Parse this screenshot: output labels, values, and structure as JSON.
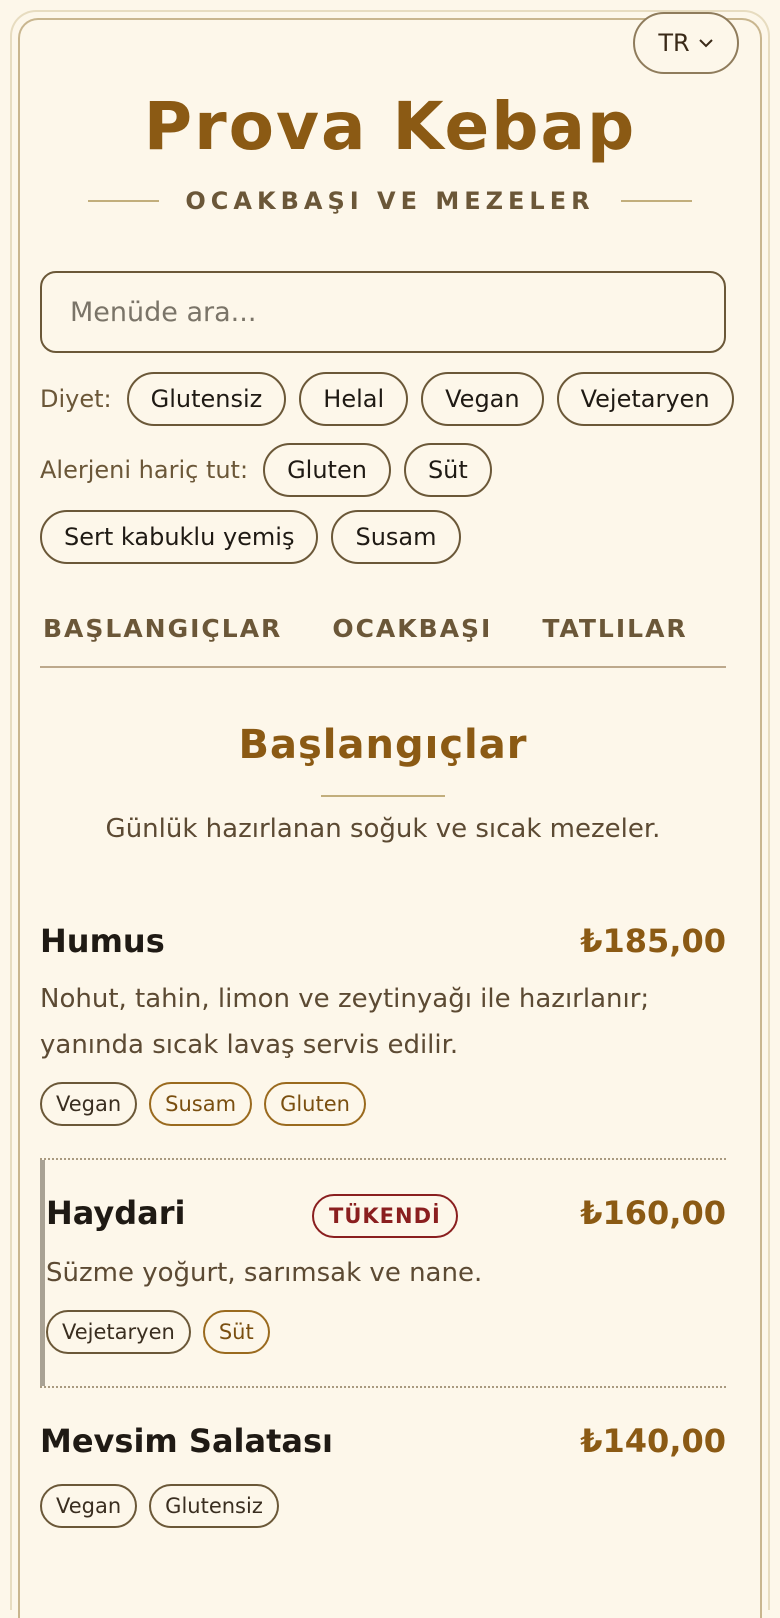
{
  "header": {
    "language": "TR",
    "restaurant_name": "Prova Kebap",
    "tagline": "OCAKBAŞI VE MEZELER"
  },
  "search": {
    "placeholder": "Menüde ara..."
  },
  "filters": {
    "diet_label": "Diyet:",
    "diet_options": [
      "Glutensiz",
      "Helal",
      "Vegan",
      "Vejetaryen"
    ],
    "allergen_label": "Alerjeni hariç tut:",
    "allergen_options": [
      "Gluten",
      "Süt",
      "Sert kabuklu yemiş",
      "Susam"
    ]
  },
  "tabs": [
    "BAŞLANGIÇLAR",
    "OCAKBAŞI",
    "TATLILAR"
  ],
  "section": {
    "title": "Başlangıçlar",
    "description": "Günlük hazırlanan soğuk ve sıcak mezeler."
  },
  "items": [
    {
      "name": "Humus",
      "price": "₺185,00",
      "description_line1": "Nohut, tahin, limon ve zeytinyağı ile hazırlanır;",
      "description_line2": "yanında sıcak lavaş servis edilir.",
      "diet_tags": [
        "Vegan"
      ],
      "allergen_tags": [
        "Susam",
        "Gluten"
      ]
    },
    {
      "name": "Haydari",
      "price": "₺160,00",
      "status": "TÜKENDİ",
      "description_line1": "Süzme yoğurt, sarımsak ve nane.",
      "diet_tags": [
        "Vejetaryen"
      ],
      "allergen_tags": [
        "Süt"
      ]
    },
    {
      "name": "Mevsim Salatası",
      "price": "₺140,00",
      "diet_tags": [
        "Vegan",
        "Glutensiz"
      ],
      "allergen_tags": []
    }
  ],
  "icons": {
    "language_dropdown": "chevron-down-icon"
  },
  "colors": {
    "accent": "#8b5a14",
    "background": "#fdf7ea",
    "soldout": "#8a1f1f"
  }
}
